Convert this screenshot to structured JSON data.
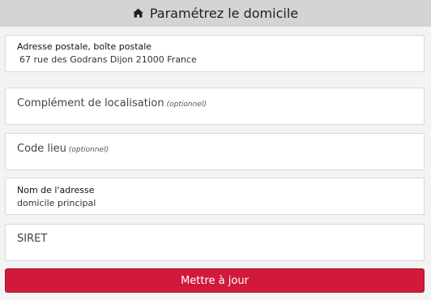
{
  "header": {
    "icon": "home-icon",
    "title": "Paramétrez le domicile"
  },
  "form": {
    "postal_address": {
      "label": "Adresse postale, boîte postale",
      "value": "67 rue des Godrans Dijon 21000 France"
    },
    "location_complement": {
      "placeholder": "Complément de localisation",
      "optional": "(optionnel)"
    },
    "place_code": {
      "placeholder": "Code lieu",
      "optional": "(optionnel)"
    },
    "address_name": {
      "label": "Nom de l'adresse",
      "value": "domicile principal"
    },
    "siret": {
      "placeholder": "SIRET"
    }
  },
  "actions": {
    "update_label": "Mettre à jour"
  },
  "colors": {
    "header_bg": "#d4d4d4",
    "button_bg": "#d11a3b"
  }
}
